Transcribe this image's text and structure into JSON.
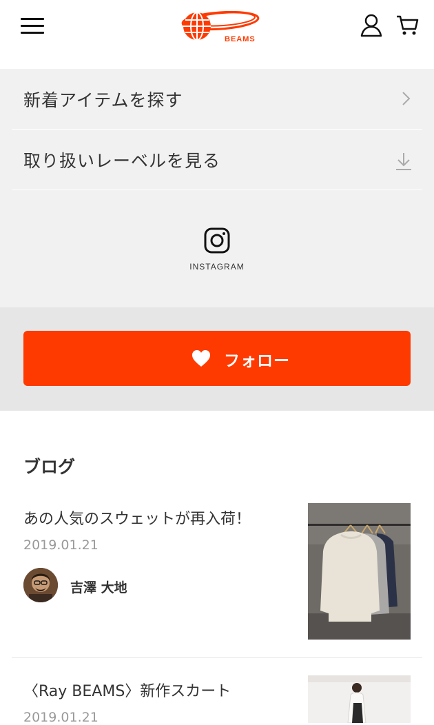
{
  "header": {
    "menu_icon": "hamburger-menu-icon",
    "logo_text": "BEAMS",
    "user_icon": "user-icon",
    "cart_icon": "cart-icon"
  },
  "nav": {
    "items": [
      {
        "label": "新着アイテムを探す",
        "icon": "chevron-right-icon"
      },
      {
        "label": "取り扱いレーベルを見る",
        "icon": "download-icon"
      }
    ],
    "instagram_label": "INSTAGRAM"
  },
  "follow": {
    "label": "フォロー",
    "icon": "heart-icon"
  },
  "blog": {
    "title": "ブログ",
    "posts": [
      {
        "title": "あの人気のスウェットが再入荷！",
        "date": "2019.01.21",
        "author": "吉澤 大地"
      },
      {
        "title": "〈Ray BEAMS〉新作スカート",
        "date": "2019.01.21"
      }
    ]
  },
  "colors": {
    "accent": "#ff3a00",
    "nav_bg": "#f1f1f1",
    "follow_bg": "#e6e6e6",
    "muted_text": "#999999"
  }
}
